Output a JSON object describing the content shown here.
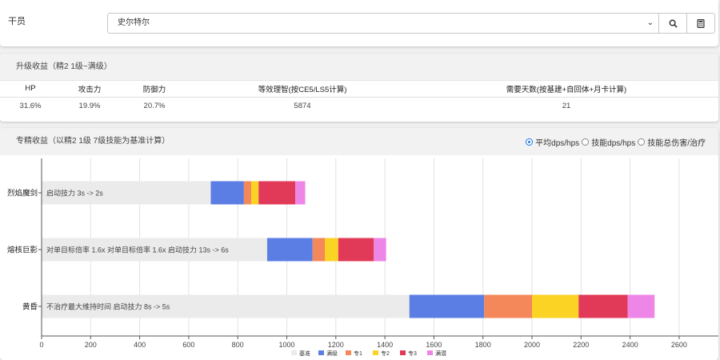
{
  "operator": {
    "label": "干员",
    "selected": "史尔特尔"
  },
  "upgrade": {
    "title": "升级收益（精2 1级~满级）",
    "headers": [
      "HP",
      "攻击力",
      "防御力",
      "等效理智(按CE5/LS5计算)",
      "需要天数(按基建+自回体+月卡计算)"
    ],
    "values": [
      "31.6%",
      "19.9%",
      "20.7%",
      "5874",
      "21"
    ]
  },
  "elite": {
    "title": "专精收益（以精2 1级 7级技能为基准计算）",
    "options": [
      "平均dps/hps",
      "技能dps/hps",
      "技能总伤害/治疗"
    ],
    "selected_option": 0
  },
  "chart_data": {
    "type": "bar",
    "orientation": "horizontal",
    "stacked": true,
    "categories": [
      "烈焰魔剑",
      "熔核巨影",
      "黄昏"
    ],
    "series": [
      {
        "name": "基准",
        "color": "#ebebeb",
        "values": [
          690,
          920,
          1500
        ]
      },
      {
        "name": "满级",
        "color": "#5b7ee5",
        "values": [
          135,
          185,
          305
        ]
      },
      {
        "name": "专1",
        "color": "#f4885a",
        "values": [
          30,
          50,
          195
        ]
      },
      {
        "name": "专2",
        "color": "#fad325",
        "values": [
          30,
          55,
          190
        ]
      },
      {
        "name": "专3",
        "color": "#e13a58",
        "values": [
          150,
          145,
          200
        ]
      },
      {
        "name": "满潜",
        "color": "#ee86e8",
        "values": [
          40,
          50,
          110
        ]
      }
    ],
    "bar_labels": [
      "启动技力 3s -> 2s",
      "对单目标倍率 1.6x 对单目标倍率 1.6x 启动技力 13s -> 6s",
      "不治疗最大维持时间 启动技力 8s -> 5s"
    ],
    "xlim": [
      0,
      2600
    ],
    "xticks": [
      0,
      200,
      400,
      600,
      800,
      1000,
      1200,
      1400,
      1600,
      1800,
      2000,
      2200,
      2400,
      2600
    ],
    "grid": true,
    "legend": "bottom"
  }
}
